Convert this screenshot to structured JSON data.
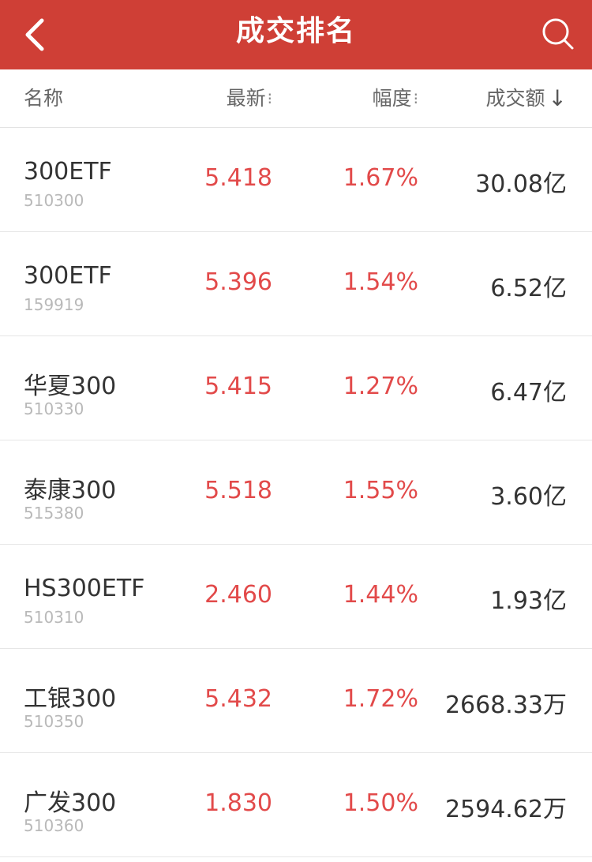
{
  "app_bar": {
    "title": "成交排名",
    "background": "#cf3f36",
    "back_icon": "chevron-left-icon",
    "search_icon": "search-icon"
  },
  "table": {
    "headers": {
      "name": "名称",
      "latest": "最新",
      "change": "幅度",
      "turnover": "成交额",
      "sort_indicator": "↓",
      "neutral_sort_indicator": "⁝"
    },
    "rows": [
      {
        "name": "300ETF",
        "code": "510300",
        "latest": "5.418",
        "change": "1.67%",
        "turnover": "30.08亿"
      },
      {
        "name": "300ETF",
        "code": "159919",
        "latest": "5.396",
        "change": "1.54%",
        "turnover": "6.52亿"
      },
      {
        "name": "华夏300",
        "code": "510330",
        "latest": "5.415",
        "change": "1.27%",
        "turnover": "6.47亿"
      },
      {
        "name": "泰康300",
        "code": "515380",
        "latest": "5.518",
        "change": "1.55%",
        "turnover": "3.60亿"
      },
      {
        "name": "HS300ETF",
        "code": "510310",
        "latest": "2.460",
        "change": "1.44%",
        "turnover": "1.93亿"
      },
      {
        "name": "工银300",
        "code": "510350",
        "latest": "5.432",
        "change": "1.72%",
        "turnover": "2668.33万"
      },
      {
        "name": "广发300",
        "code": "510360",
        "latest": "1.830",
        "change": "1.50%",
        "turnover": "2594.62万"
      }
    ]
  },
  "colors": {
    "price_up": "#e24a4a",
    "text_primary": "#333333",
    "text_secondary": "#b9b9b9",
    "divider": "#e6e6e6"
  }
}
